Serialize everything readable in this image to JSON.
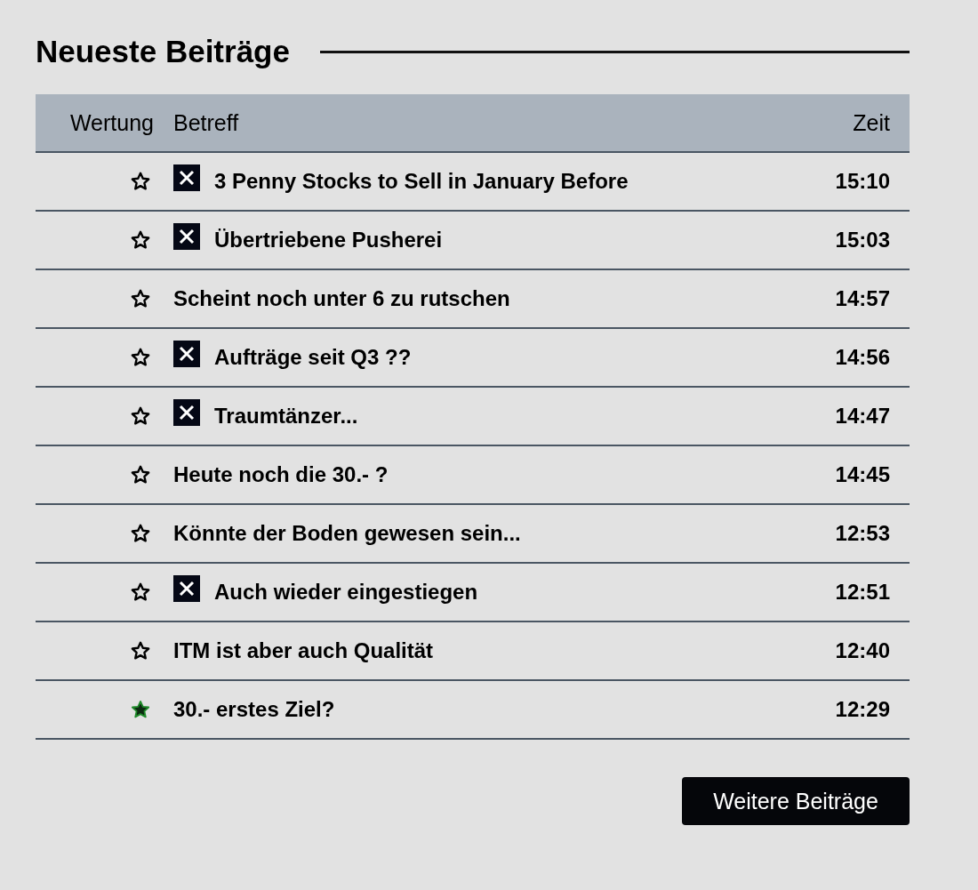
{
  "title": "Neueste Beiträge",
  "table": {
    "columns": [
      "Wertung",
      "Betreff",
      "Zeit"
    ],
    "rows": [
      {
        "rated": false,
        "x_marked": true,
        "subject": "3 Penny Stocks to Sell in January Before",
        "time": "15:10"
      },
      {
        "rated": false,
        "x_marked": true,
        "subject": "Übertriebene Pusherei",
        "time": "15:03"
      },
      {
        "rated": false,
        "x_marked": false,
        "subject": "Scheint noch unter 6 zu rutschen",
        "time": "14:57"
      },
      {
        "rated": false,
        "x_marked": true,
        "subject": "Aufträge seit Q3 ??",
        "time": "14:56"
      },
      {
        "rated": false,
        "x_marked": true,
        "subject": "Traumtänzer...",
        "time": "14:47"
      },
      {
        "rated": false,
        "x_marked": false,
        "subject": "Heute noch die 30.- ?",
        "time": "14:45"
      },
      {
        "rated": false,
        "x_marked": false,
        "subject": "Könnte der Boden gewesen sein...",
        "time": "12:53"
      },
      {
        "rated": false,
        "x_marked": true,
        "subject": "Auch wieder eingestiegen",
        "time": "12:51"
      },
      {
        "rated": false,
        "x_marked": false,
        "subject": "ITM ist aber auch Qualität",
        "time": "12:40"
      },
      {
        "rated": true,
        "x_marked": false,
        "subject": "30.- erstes Ziel?",
        "time": "12:29"
      }
    ]
  },
  "more_button": "Weitere Beiträge"
}
